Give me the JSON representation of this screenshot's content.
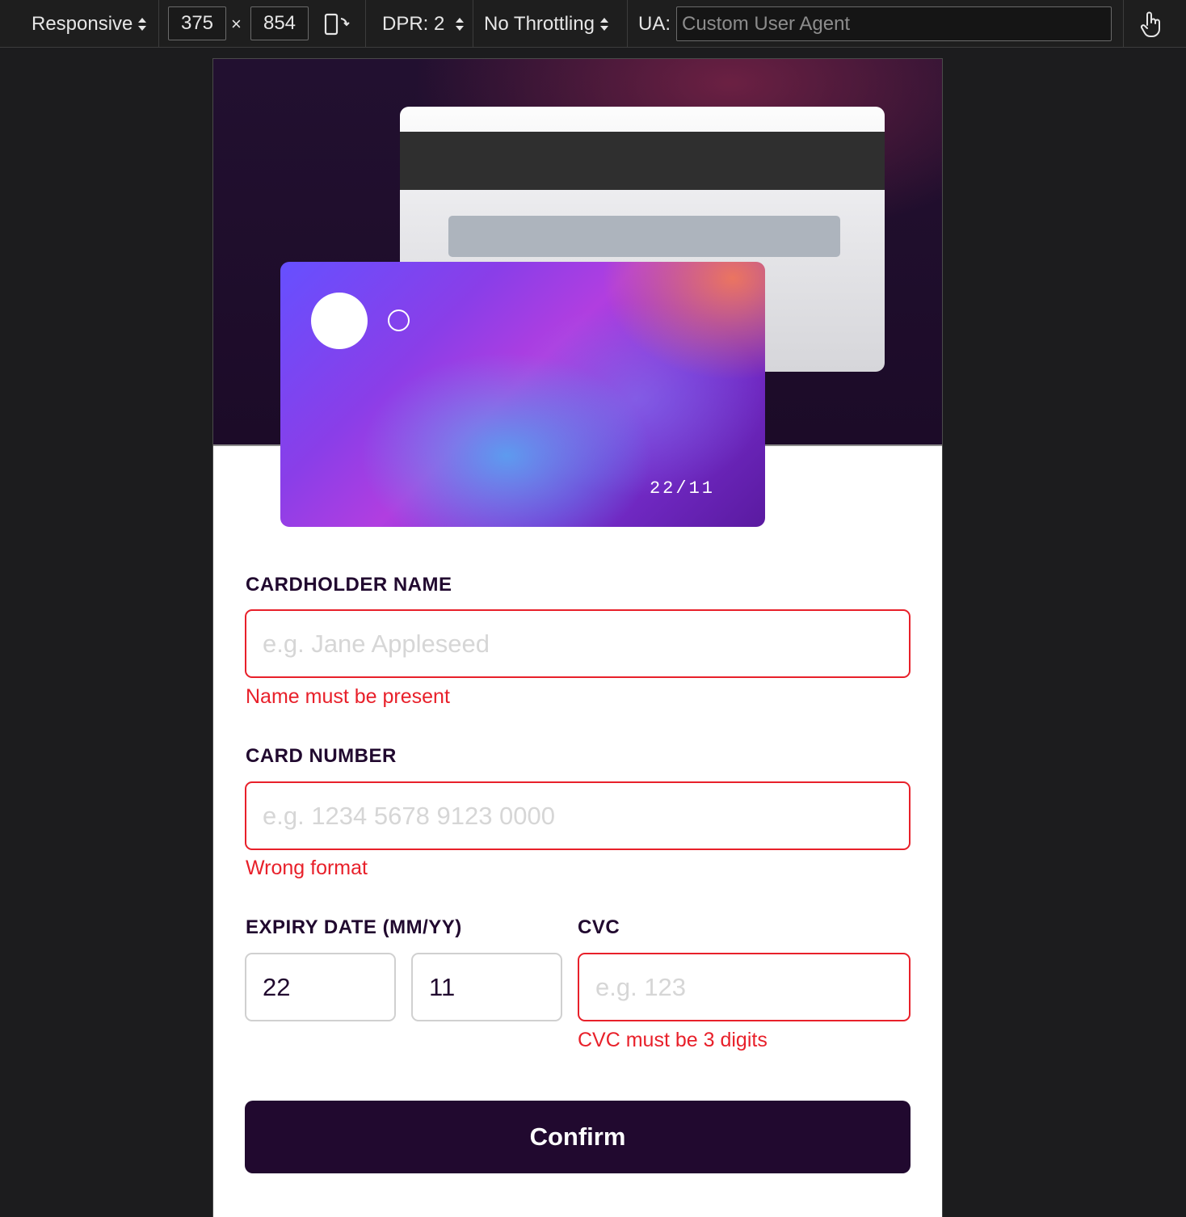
{
  "toolbar": {
    "device": "Responsive",
    "width": "375",
    "times": "×",
    "height": "854",
    "dpr": "DPR: 2",
    "throttling": "No Throttling",
    "ua_label": "UA:",
    "ua_placeholder": "Custom User Agent",
    "icons": [
      "rotate-device-icon",
      "touch-icon"
    ]
  },
  "card": {
    "expiry": "22/11"
  },
  "form": {
    "name_label": "CARDHOLDER NAME",
    "name_placeholder": "e.g. Jane Appleseed",
    "name_error": "Name must be present",
    "number_label": "CARD NUMBER",
    "number_placeholder": "e.g. 1234 5678 9123 0000",
    "number_error": "Wrong format",
    "expiry_label": "EXPIRY DATE (MM/YY)",
    "expiry_month": "22",
    "expiry_year": "11",
    "cvc_label": "CVC",
    "cvc_placeholder": "e.g. 123",
    "cvc_error": "CVC must be 3 digits",
    "confirm_label": "Confirm"
  },
  "colors": {
    "error": "#e8202a",
    "dark_violet": "#21092f",
    "hero_bg": "#1c0b28"
  }
}
